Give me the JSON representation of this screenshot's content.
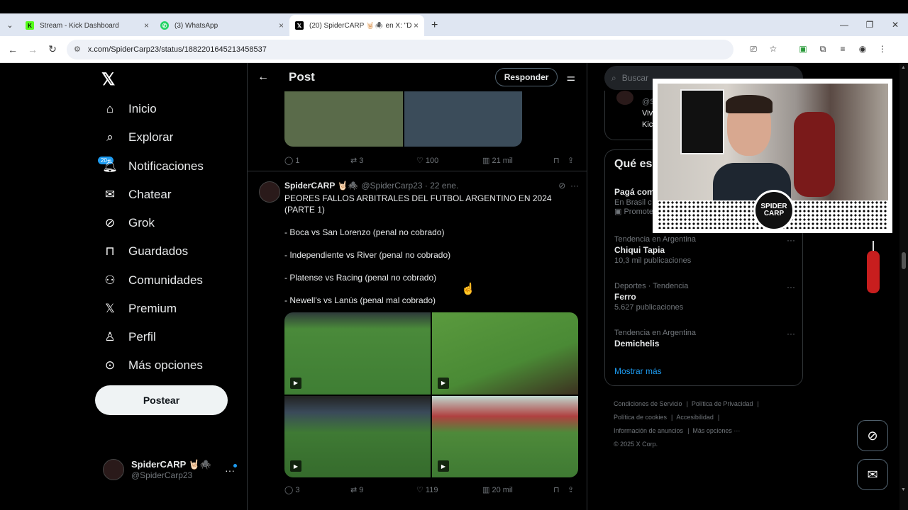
{
  "browser": {
    "tabs": [
      {
        "title": "Stream - Kick Dashboard",
        "icon": "kick-icon"
      },
      {
        "title": "(3) WhatsApp",
        "icon": "whatsapp-icon"
      },
      {
        "title": "(20) SpiderCARP 🤘🏻🕷️ en X: \"D",
        "icon": "x-icon"
      }
    ],
    "url": "x.com/SpiderCarp23/status/1882201645213458537"
  },
  "nav": {
    "items": [
      "Inicio",
      "Explorar",
      "Notificaciones",
      "Chatear",
      "Grok",
      "Guardados",
      "Comunidades",
      "Premium",
      "Perfil",
      "Más opciones"
    ],
    "badge": "20+",
    "post_button": "Postear",
    "account_name": "SpiderCARP 🤘🏻🕷️",
    "account_handle": "@SpiderCarp23"
  },
  "header": {
    "title": "Post",
    "reply_button": "Responder"
  },
  "prev_tweet_actions": {
    "replies": "1",
    "reposts": "3",
    "likes": "100",
    "views": "21 mil"
  },
  "tweet": {
    "name": "SpiderCARP 🤘🏻🕷️",
    "handle_date": "@SpiderCarp23 · 22 ene.",
    "lines": [
      "PEORES FALLOS ARBITRALES DEL FUTBOL ARGENTINO EN 2024 (PARTE 1)",
      "- Boca vs San Lorenzo (penal no cobrado)",
      "- Independiente vs River (penal no cobrado)",
      "- Platense vs Racing (penal no cobrado)",
      "- Newell's vs Lanús (penal mal cobrado)"
    ],
    "actions": {
      "replies": "3",
      "reposts": "9",
      "likes": "119",
      "views": "20 mil"
    }
  },
  "right": {
    "search_placeholder": "Buscar",
    "who_handle": "@S",
    "who_line1": "Viv",
    "who_line2": "Kic",
    "trends_title": "Qué es",
    "promo_name": "Pagá com",
    "promo_line": "En Brasil c",
    "promo_label": "Promote",
    "trends": [
      {
        "context": "Tendencia en Argentina",
        "name": "Chiqui Tapia",
        "count": "10,3 mil publicaciones"
      },
      {
        "context": "Deportes · Tendencia",
        "name": "Ferro",
        "count": "5.627 publicaciones"
      },
      {
        "context": "Tendencia en Argentina",
        "name": "Demichelis",
        "count": ""
      }
    ],
    "show_more": "Mostrar más",
    "footer": [
      "Condiciones de Servicio",
      "Política de Privacidad",
      "Política de cookies",
      "Accesibilidad",
      "Información de anuncios",
      "Más opciones ···",
      "© 2025 X Corp."
    ]
  },
  "overlay": {
    "logo_text": "SPIDER CARP"
  }
}
